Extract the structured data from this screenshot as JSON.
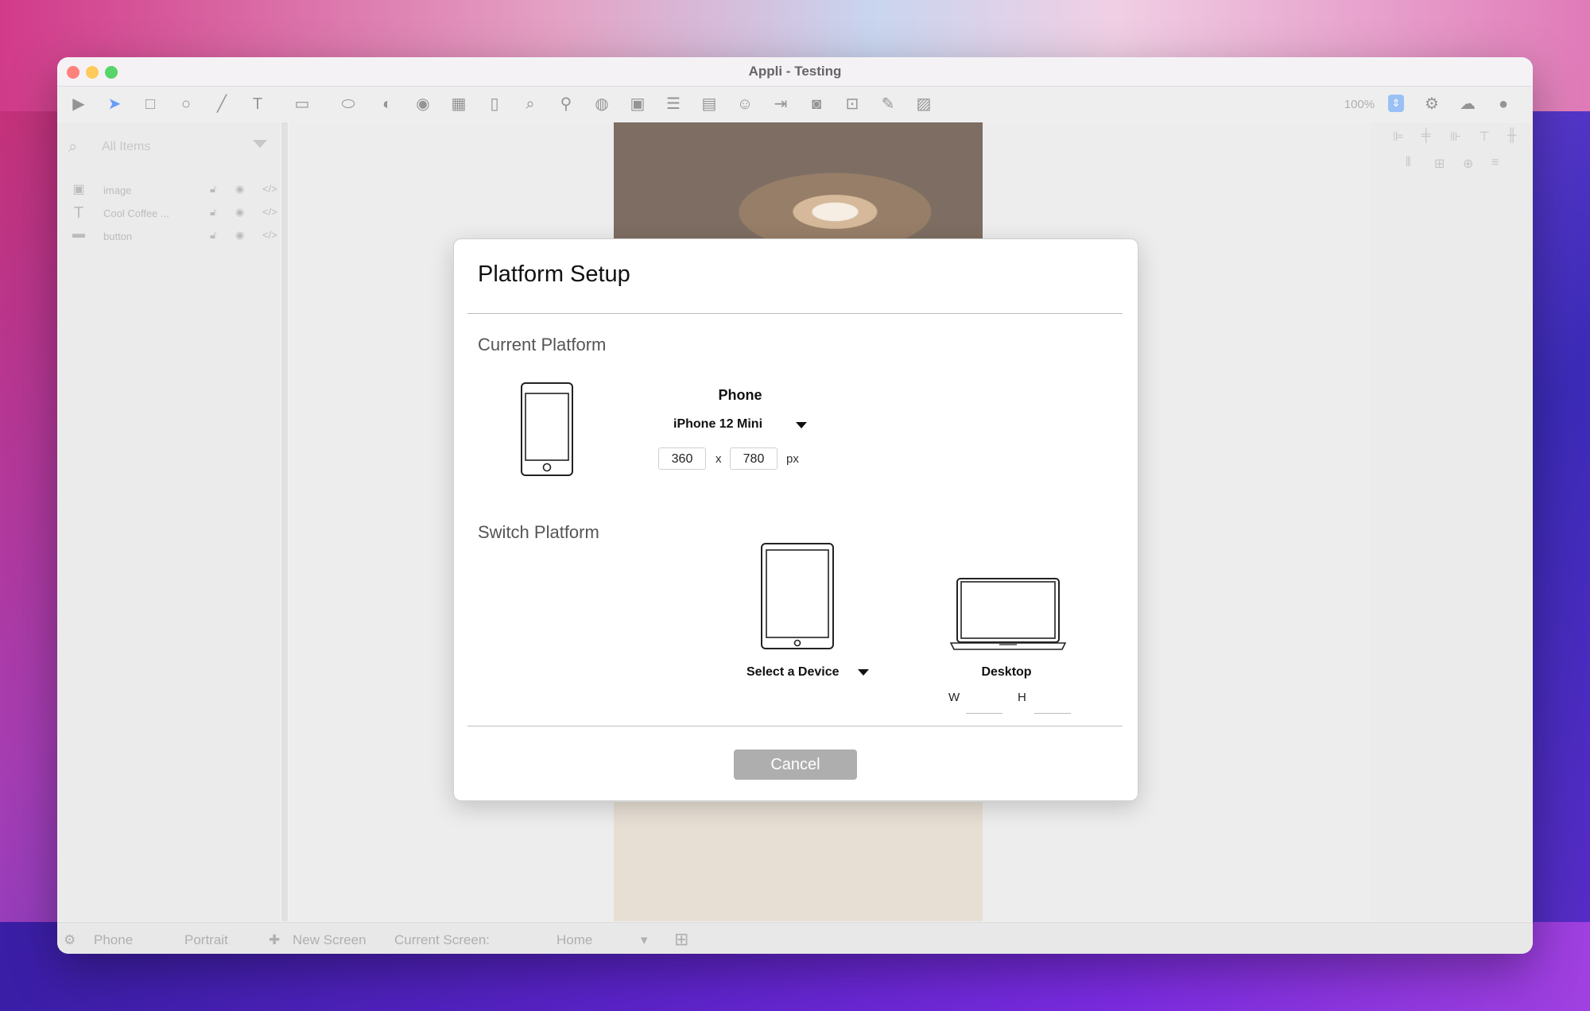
{
  "window": {
    "title": "Appli - Testing"
  },
  "toolbar": {
    "zoom": "100%",
    "tools": [
      "play-icon",
      "pointer-icon",
      "rectangle-icon",
      "ellipse-icon",
      "line-icon",
      "text-icon",
      "textfield-icon",
      "button-shape-icon",
      "toggle-icon",
      "radio-icon",
      "table-icon",
      "page-icon",
      "search-icon",
      "map-pin-icon",
      "globe-icon",
      "image-icon",
      "list-icon",
      "form-icon",
      "user-add-icon",
      "login-icon",
      "camera-icon",
      "video-icon",
      "edit-icon",
      "chart-icon"
    ],
    "right_icons": [
      "gear-icon",
      "cloud-upload-icon",
      "account-icon"
    ]
  },
  "sidebar": {
    "search_placeholder": "All Items",
    "layers": [
      {
        "label": "image",
        "icon": "image-icon"
      },
      {
        "label": "Cool Coffee ...",
        "icon": "text-icon"
      },
      {
        "label": "button",
        "icon": "button-shape-icon"
      }
    ]
  },
  "statusbar": {
    "platform": "Phone",
    "orientation": "Portrait",
    "new_screen": "New Screen",
    "current_screen_label": "Current Screen:",
    "current_screen_value": "Home"
  },
  "dialog": {
    "title": "Platform Setup",
    "current_section": "Current Platform",
    "current_platform_name": "Phone",
    "current_device": "iPhone 12 Mini",
    "width_value": "360",
    "x_sep": "x",
    "height_value": "780",
    "unit": "px",
    "switch_section": "Switch Platform",
    "select_device_label": "Select a Device",
    "desktop_label": "Desktop",
    "w_label": "W",
    "h_label": "H",
    "cancel_label": "Cancel"
  }
}
